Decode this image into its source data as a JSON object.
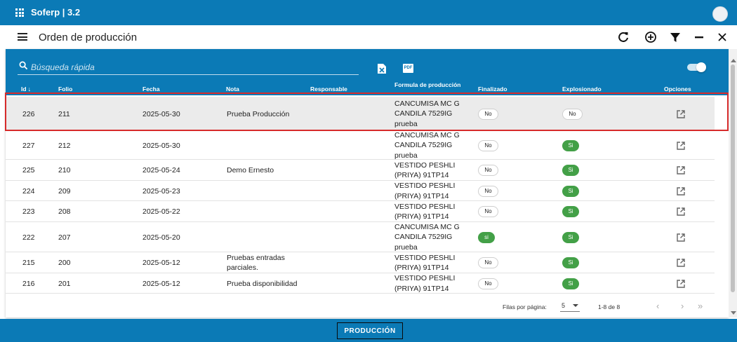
{
  "app": {
    "title": "Soferp | 3.2"
  },
  "toolbar": {
    "title": "Orden de producción"
  },
  "search": {
    "placeholder": "Búsqueda rápida"
  },
  "table": {
    "columns": {
      "id": "Id",
      "folio": "Folio",
      "fecha": "Fecha",
      "nota": "Nota",
      "responsable": "Responsable",
      "formula": "Formula de producción",
      "finalizado": "Finalizado",
      "explosionado": "Explosionado",
      "opciones": "Opciones"
    },
    "rows": [
      {
        "id": "226",
        "folio": "211",
        "fecha": "2025-05-30",
        "nota": "Prueba Producción",
        "formula": "CANCUMISA MC G CANDILA 7529IG prueba",
        "finalizado": "No",
        "explosionado": "No"
      },
      {
        "id": "227",
        "folio": "212",
        "fecha": "2025-05-30",
        "nota": "",
        "formula": "CANCUMISA MC G CANDILA 7529IG prueba",
        "finalizado": "No",
        "explosionado": "Si"
      },
      {
        "id": "225",
        "folio": "210",
        "fecha": "2025-05-24",
        "nota": "Demo Ernesto",
        "formula": "VESTIDO PESHLI (PRIYA) 91TP14",
        "finalizado": "No",
        "explosionado": "Si"
      },
      {
        "id": "224",
        "folio": "209",
        "fecha": "2025-05-23",
        "nota": "",
        "formula": "VESTIDO PESHLI (PRIYA) 91TP14",
        "finalizado": "No",
        "explosionado": "Si"
      },
      {
        "id": "223",
        "folio": "208",
        "fecha": "2025-05-22",
        "nota": "",
        "formula": "VESTIDO PESHLI (PRIYA) 91TP14",
        "finalizado": "No",
        "explosionado": "Si"
      },
      {
        "id": "222",
        "folio": "207",
        "fecha": "2025-05-20",
        "nota": "",
        "formula": "CANCUMISA MC G CANDILA 7529IG prueba",
        "finalizado": "si",
        "explosionado": "Si"
      },
      {
        "id": "215",
        "folio": "200",
        "fecha": "2025-05-12",
        "nota": "Pruebas entradas parciales.",
        "formula": "VESTIDO PESHLI (PRIYA) 91TP14",
        "finalizado": "No",
        "explosionado": "Si"
      },
      {
        "id": "216",
        "folio": "201",
        "fecha": "2025-05-12",
        "nota": "Prueba disponibilidad",
        "formula": "VESTIDO PESHLI (PRIYA) 91TP14",
        "finalizado": "No",
        "explosionado": "Si"
      }
    ]
  },
  "pagination": {
    "rows_label": "Filas por página:",
    "rows_per_page": "5",
    "range": "1-8 de 8"
  },
  "footer": {
    "button_label": "PRODUCCIÓN"
  },
  "colors": {
    "primary": "#0b7ab6",
    "success": "#43a047",
    "highlight": "#d62b2b"
  }
}
